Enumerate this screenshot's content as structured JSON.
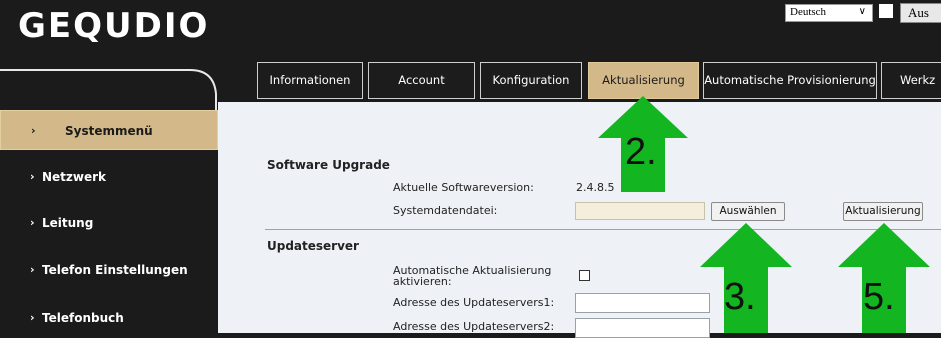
{
  "header": {
    "logo_text": "GEQUDIO",
    "language_value": "Deutsch",
    "logout_label": "Aus"
  },
  "tabs": [
    {
      "label": "Informationen",
      "active": false
    },
    {
      "label": "Account",
      "active": false
    },
    {
      "label": "Konfiguration",
      "active": false
    },
    {
      "label": "Aktualisierung",
      "active": true
    },
    {
      "label": "Automatische Provisionierung",
      "active": false
    },
    {
      "label": "Werkz",
      "active": false
    }
  ],
  "sidebar": {
    "items": [
      {
        "label": "Systemmenü",
        "active": true
      },
      {
        "label": "Netzwerk",
        "active": false
      },
      {
        "label": "Leitung",
        "active": false
      },
      {
        "label": "Telefon Einstellungen",
        "active": false
      },
      {
        "label": "Telefonbuch",
        "active": false
      }
    ]
  },
  "software_upgrade": {
    "title": "Software Upgrade",
    "current_version_label": "Aktuelle Softwareversion:",
    "current_version_value": "2.4.8.5",
    "system_file_label": "Systemdatendatei:",
    "system_file_value": "",
    "choose_button": "Auswählen",
    "update_button": "Aktualisierung"
  },
  "update_server": {
    "title": "Updateserver",
    "auto_update_label": "Automatische Aktualisierung aktivieren:",
    "auto_update_checked": false,
    "server1_label": "Adresse des Updateservers1:",
    "server1_value": "",
    "server2_label": "Adresse des Updateservers2:",
    "server2_value": ""
  },
  "annotations": {
    "step2": "2.",
    "step3": "3.",
    "step5": "5.",
    "arrow_color": "#13b521"
  },
  "colors": {
    "accent": "#d3b989",
    "background_dark": "#1b1b1b",
    "content_bg": "#eef2f7"
  }
}
